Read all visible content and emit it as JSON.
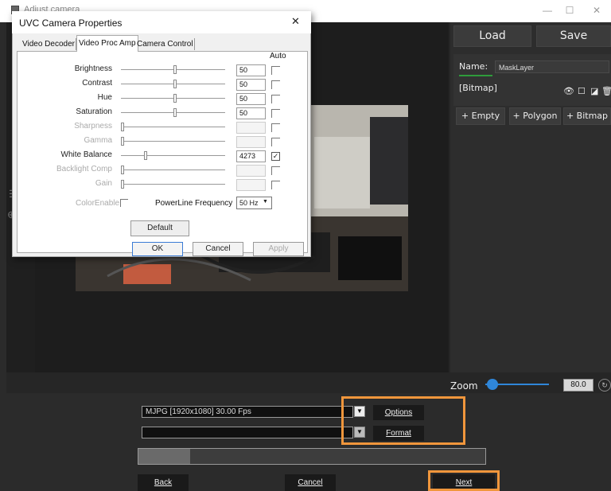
{
  "app": {
    "title": "Adjust camera",
    "window_controls": {
      "minimize": "—",
      "maximize": "☐",
      "close": "✕"
    }
  },
  "right_panel": {
    "load_label": "Load",
    "save_label": "Save",
    "name_label": "Name:",
    "name_value": "MaskLayer",
    "layer_type": "[Bitmap]",
    "add_empty": "+ Empty",
    "add_polygon": "+ Polygon",
    "add_bitmap": "+ Bitmap"
  },
  "zoom": {
    "label": "Zoom",
    "value": "80.0",
    "reset_icon": "↻"
  },
  "source": {
    "format_value": "MJPG  [1920x1080]  30.00 Fps",
    "second_value": "",
    "options_label": "Options",
    "format_label": "Format",
    "progress_fraction": 0.15
  },
  "nav": {
    "back_label": "Back",
    "cancel_label": "Cancel",
    "next_label": "Next"
  },
  "highlight_color": "#f0963c",
  "dialog": {
    "title": "UVC Camera Properties",
    "close_icon": "✕",
    "tabs": [
      "Video Decoder",
      "Video Proc Amp",
      "Camera Control"
    ],
    "auto_header": "Auto",
    "properties": [
      {
        "label": "Brightness",
        "value": "50",
        "enabled": true,
        "auto": false
      },
      {
        "label": "Contrast",
        "value": "50",
        "enabled": true,
        "auto": false
      },
      {
        "label": "Hue",
        "value": "50",
        "enabled": true,
        "auto": false
      },
      {
        "label": "Saturation",
        "value": "50",
        "enabled": true,
        "auto": false
      },
      {
        "label": "Sharpness",
        "value": "",
        "enabled": false,
        "auto": false
      },
      {
        "label": "Gamma",
        "value": "",
        "enabled": false,
        "auto": false
      },
      {
        "label": "White Balance",
        "value": "4273",
        "enabled": true,
        "auto": true
      },
      {
        "label": "Backlight Comp",
        "value": "",
        "enabled": false,
        "auto": false
      },
      {
        "label": "Gain",
        "value": "",
        "enabled": false,
        "auto": false
      }
    ],
    "colorenable_label": "ColorEnable",
    "powerline_label": "PowerLine Frequency",
    "powerline_value": "50 Hz",
    "default_label": "Default",
    "ok_label": "OK",
    "cancel_label": "Cancel",
    "apply_label": "Apply"
  }
}
